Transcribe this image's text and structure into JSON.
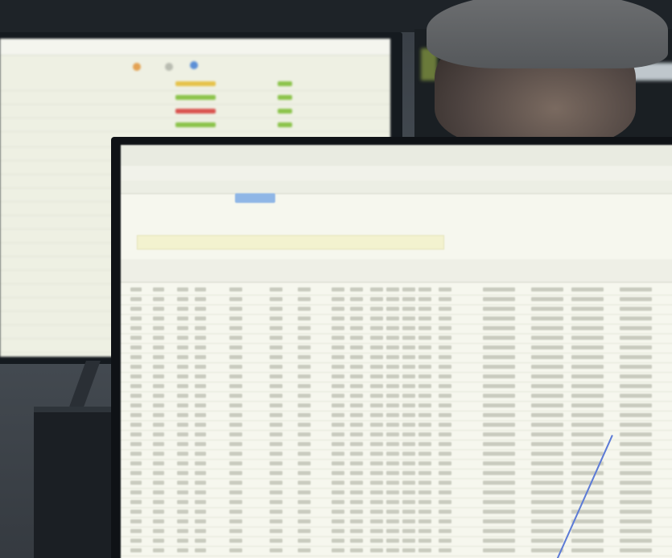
{
  "scene": {
    "description_label": "",
    "colors": {
      "back_screen": "#eef0e3",
      "front_screen": "#f6f7ee",
      "status_yellow": "#e6c24a",
      "status_green": "#8bc34a",
      "status_red": "#d9534f",
      "accent_blue": "#8fb6e6",
      "filter_yellow": "#f3f2cf"
    }
  },
  "back_monitor": {
    "rows": [
      {
        "status": "yellow"
      },
      {
        "status": "green"
      },
      {
        "status": "red"
      },
      {
        "status": "green"
      }
    ]
  },
  "front_monitor": {
    "table_row_count": 28
  }
}
